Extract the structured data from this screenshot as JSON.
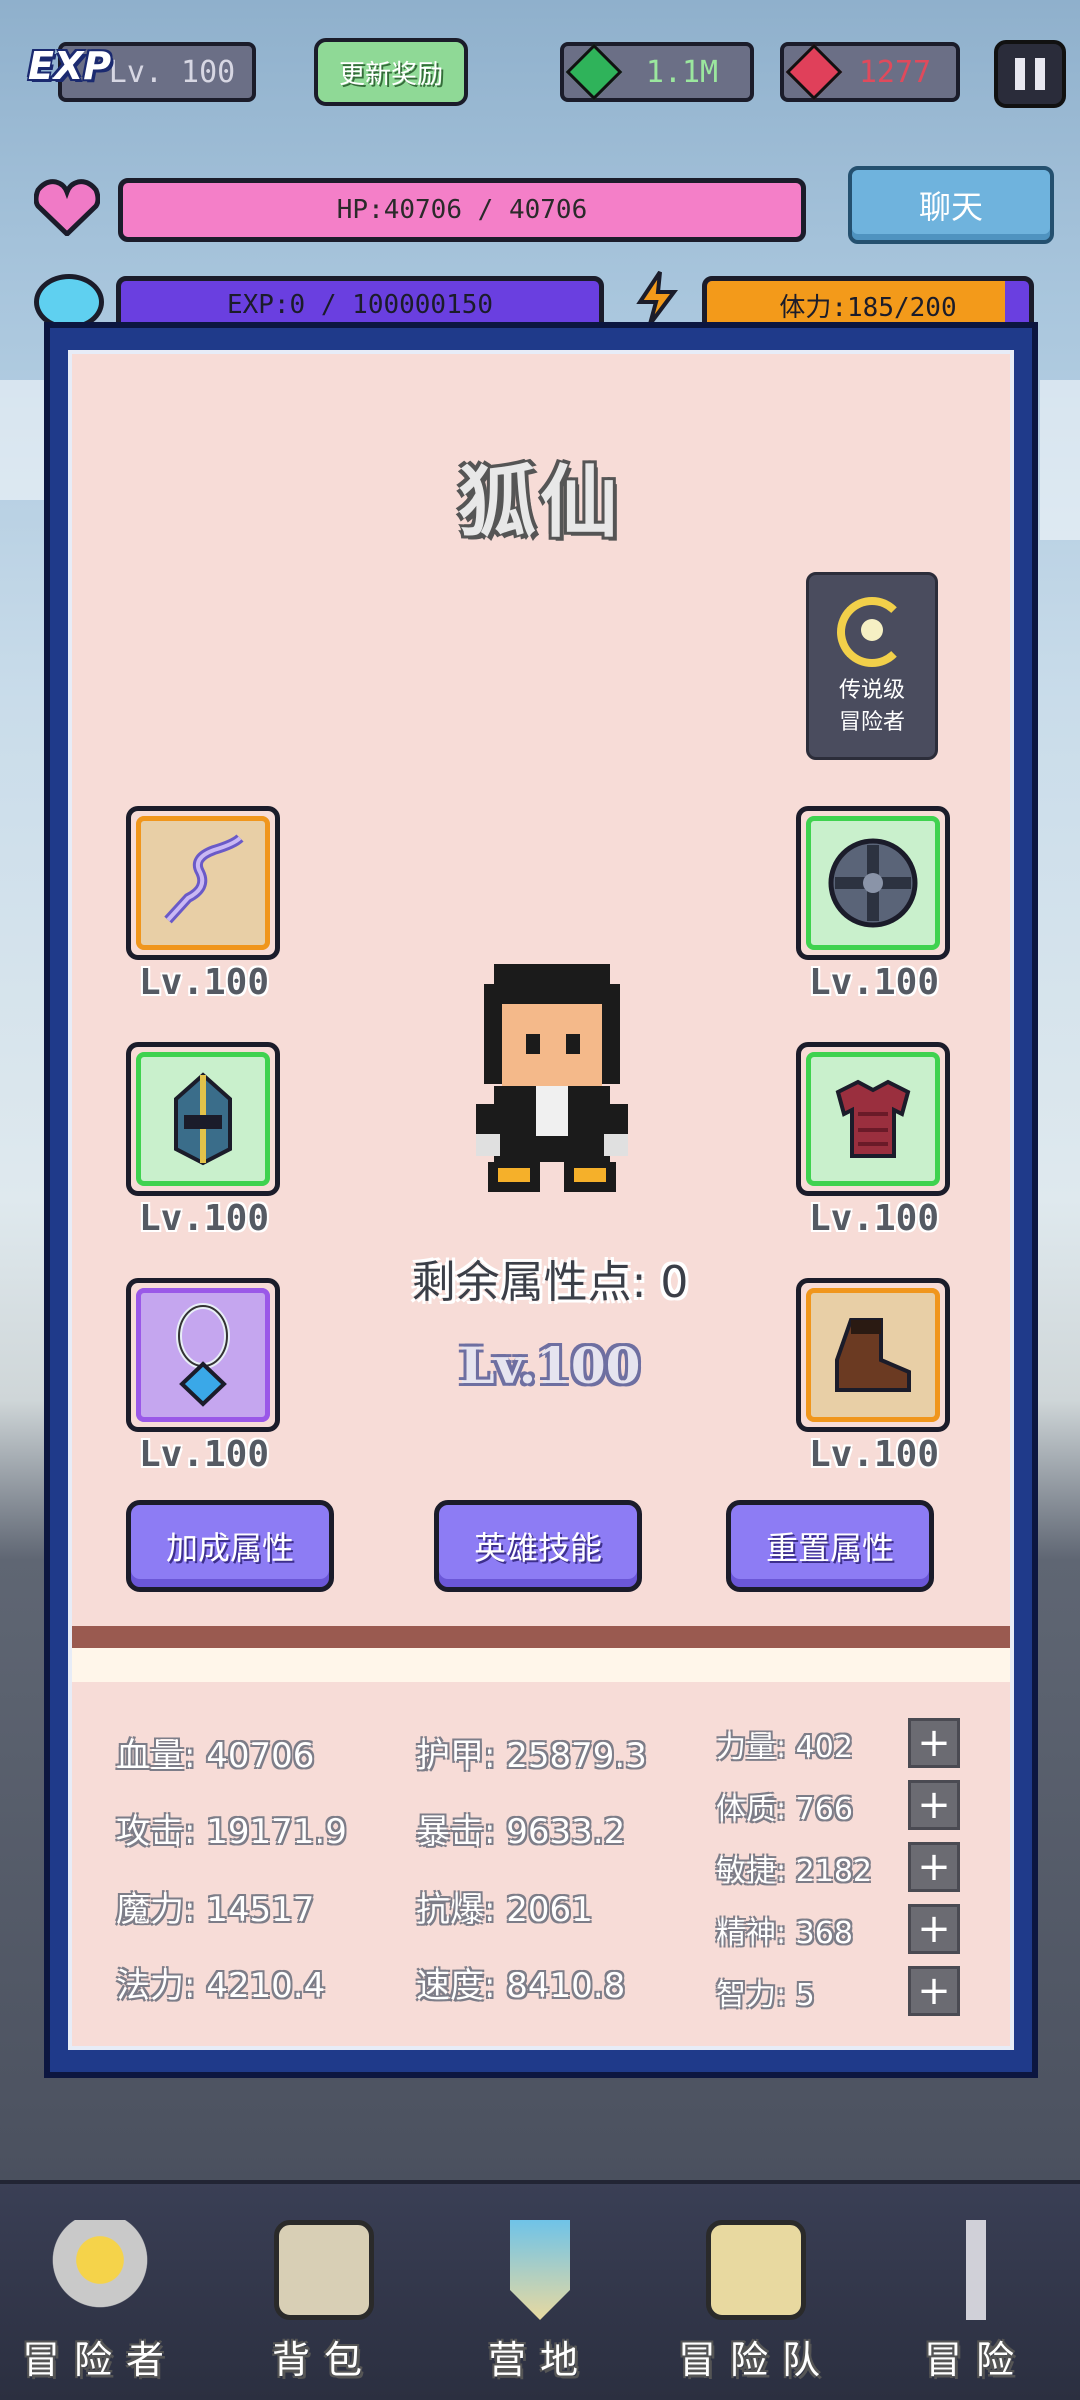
{
  "top_bar": {
    "exp_badge": "EXP",
    "level": "Lv. 100",
    "update_reward_label": "更新奖励",
    "emerald_amount": "1.1M",
    "ruby_amount": "1277"
  },
  "status_bars": {
    "hp_text": "HP:40706 / 40706",
    "hp_fill": 1.0,
    "exp_text": "EXP:0 / 100000150",
    "exp_fill": 0.0,
    "stamina_text": "体力:185/200",
    "stamina_fill": 0.925,
    "chat_label": "聊天"
  },
  "hero": {
    "name": "狐仙",
    "rank_line1": "传说级",
    "rank_line2": "冒险者",
    "remaining_points": "剩余属性点: 0",
    "level": "Lv.100"
  },
  "equipment": {
    "left": [
      {
        "icon": "whip-icon",
        "level": "Lv.100",
        "rarity": "orange"
      },
      {
        "icon": "helmet-icon",
        "level": "Lv.100",
        "rarity": "green"
      },
      {
        "icon": "necklace-icon",
        "level": "Lv.100",
        "rarity": "purple"
      }
    ],
    "right": [
      {
        "icon": "shield-icon",
        "level": "Lv.100",
        "rarity": "green"
      },
      {
        "icon": "armor-icon",
        "level": "Lv.100",
        "rarity": "green"
      },
      {
        "icon": "boots-icon",
        "level": "Lv.100",
        "rarity": "orange"
      }
    ]
  },
  "actions": {
    "bonus_attributes": "加成属性",
    "hero_skills": "英雄技能",
    "reset_attributes": "重置属性"
  },
  "stats": {
    "col1": [
      "血量: 40706",
      "攻击: 19171.9",
      "魔力: 14517",
      "法力: 4210.4"
    ],
    "col2": [
      "护甲: 25879.3",
      "暴击: 9633.2",
      "抗爆: 2061",
      "速度: 8410.8"
    ],
    "col3": [
      "力量: 402",
      "体质: 766",
      "敏捷: 2182",
      "精神: 368",
      "智力: 5"
    ],
    "plus_label": "+"
  },
  "nav": {
    "items": [
      "冒险者",
      "背包",
      "营地",
      "冒险队",
      "冒险"
    ]
  },
  "colors": {
    "panel_border": "#1f3a8a",
    "hp": "#f47fc8",
    "exp": "#6a3fe0",
    "stamina": "#f39a1a",
    "action_button": "#8d7cf4"
  }
}
